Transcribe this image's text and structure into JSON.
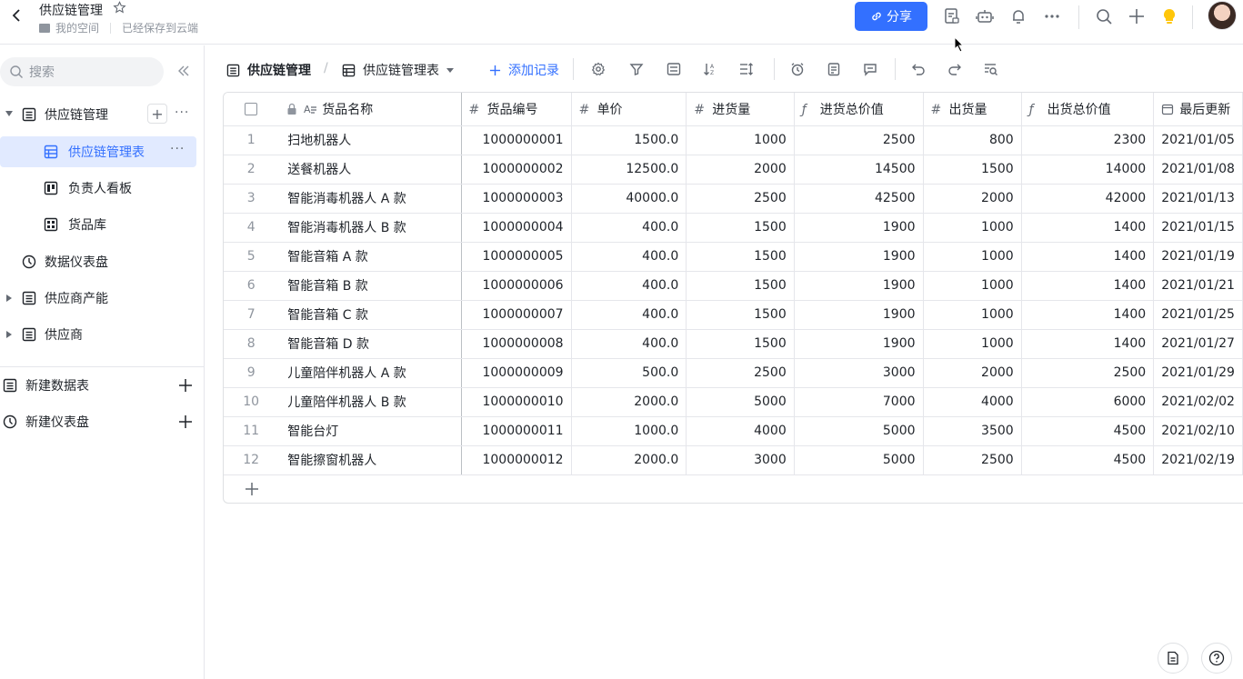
{
  "header": {
    "title": "供应链管理",
    "location": "我的空间",
    "save_status": "已经保存到云端",
    "share_label": "分享"
  },
  "sidebar": {
    "search_placeholder": "搜索",
    "items": [
      {
        "label": "供应链管理",
        "expanded": true
      },
      {
        "label": "供应链管理表",
        "active": true
      },
      {
        "label": "负责人看板"
      },
      {
        "label": "货品库"
      },
      {
        "label": "数据仪表盘"
      },
      {
        "label": "供应商产能",
        "expanded": false
      },
      {
        "label": "供应商",
        "expanded": false
      }
    ],
    "new_table": "新建数据表",
    "new_dashboard": "新建仪表盘"
  },
  "toolbar": {
    "base_name": "供应链管理",
    "view_name": "供应链管理表",
    "add_record": "添加记录"
  },
  "table": {
    "columns": [
      "货品名称",
      "货品编号",
      "单价",
      "进货量",
      "进货总价值",
      "出货量",
      "出货总价值",
      "最后更新"
    ],
    "rows": [
      {
        "idx": "1",
        "name": "扫地机器人",
        "code": "1000000001",
        "price": "1500.0",
        "in_qty": "1000",
        "in_val": "2500",
        "out_qty": "800",
        "out_val": "2300",
        "date": "2021/01/05"
      },
      {
        "idx": "2",
        "name": "送餐机器人",
        "code": "1000000002",
        "price": "12500.0",
        "in_qty": "2000",
        "in_val": "14500",
        "out_qty": "1500",
        "out_val": "14000",
        "date": "2021/01/08"
      },
      {
        "idx": "3",
        "name": "智能消毒机器人 A 款",
        "code": "1000000003",
        "price": "40000.0",
        "in_qty": "2500",
        "in_val": "42500",
        "out_qty": "2000",
        "out_val": "42000",
        "date": "2021/01/13"
      },
      {
        "idx": "4",
        "name": "智能消毒机器人 B 款",
        "code": "1000000004",
        "price": "400.0",
        "in_qty": "1500",
        "in_val": "1900",
        "out_qty": "1000",
        "out_val": "1400",
        "date": "2021/01/15"
      },
      {
        "idx": "5",
        "name": "智能音箱 A 款",
        "code": "1000000005",
        "price": "400.0",
        "in_qty": "1500",
        "in_val": "1900",
        "out_qty": "1000",
        "out_val": "1400",
        "date": "2021/01/19"
      },
      {
        "idx": "6",
        "name": "智能音箱 B 款",
        "code": "1000000006",
        "price": "400.0",
        "in_qty": "1500",
        "in_val": "1900",
        "out_qty": "1000",
        "out_val": "1400",
        "date": "2021/01/21"
      },
      {
        "idx": "7",
        "name": "智能音箱 C 款",
        "code": "1000000007",
        "price": "400.0",
        "in_qty": "1500",
        "in_val": "1900",
        "out_qty": "1000",
        "out_val": "1400",
        "date": "2021/01/25"
      },
      {
        "idx": "8",
        "name": "智能音箱 D 款",
        "code": "1000000008",
        "price": "400.0",
        "in_qty": "1500",
        "in_val": "1900",
        "out_qty": "1000",
        "out_val": "1400",
        "date": "2021/01/27"
      },
      {
        "idx": "9",
        "name": "儿童陪伴机器人 A 款",
        "code": "1000000009",
        "price": "500.0",
        "in_qty": "2500",
        "in_val": "3000",
        "out_qty": "2000",
        "out_val": "2500",
        "date": "2021/01/29"
      },
      {
        "idx": "10",
        "name": "儿童陪伴机器人 B 款",
        "code": "1000000010",
        "price": "2000.0",
        "in_qty": "5000",
        "in_val": "7000",
        "out_qty": "4000",
        "out_val": "6000",
        "date": "2021/02/02"
      },
      {
        "idx": "11",
        "name": "智能台灯",
        "code": "1000000011",
        "price": "1000.0",
        "in_qty": "4000",
        "in_val": "5000",
        "out_qty": "3500",
        "out_val": "4500",
        "date": "2021/02/10"
      },
      {
        "idx": "12",
        "name": "智能擦窗机器人",
        "code": "1000000012",
        "price": "2000.0",
        "in_qty": "3000",
        "in_val": "5000",
        "out_qty": "2500",
        "out_val": "4500",
        "date": "2021/02/19"
      }
    ]
  },
  "colors": {
    "accent": "#3370ff",
    "active_bg": "#e1eaff",
    "border": "#e5e6eb"
  }
}
